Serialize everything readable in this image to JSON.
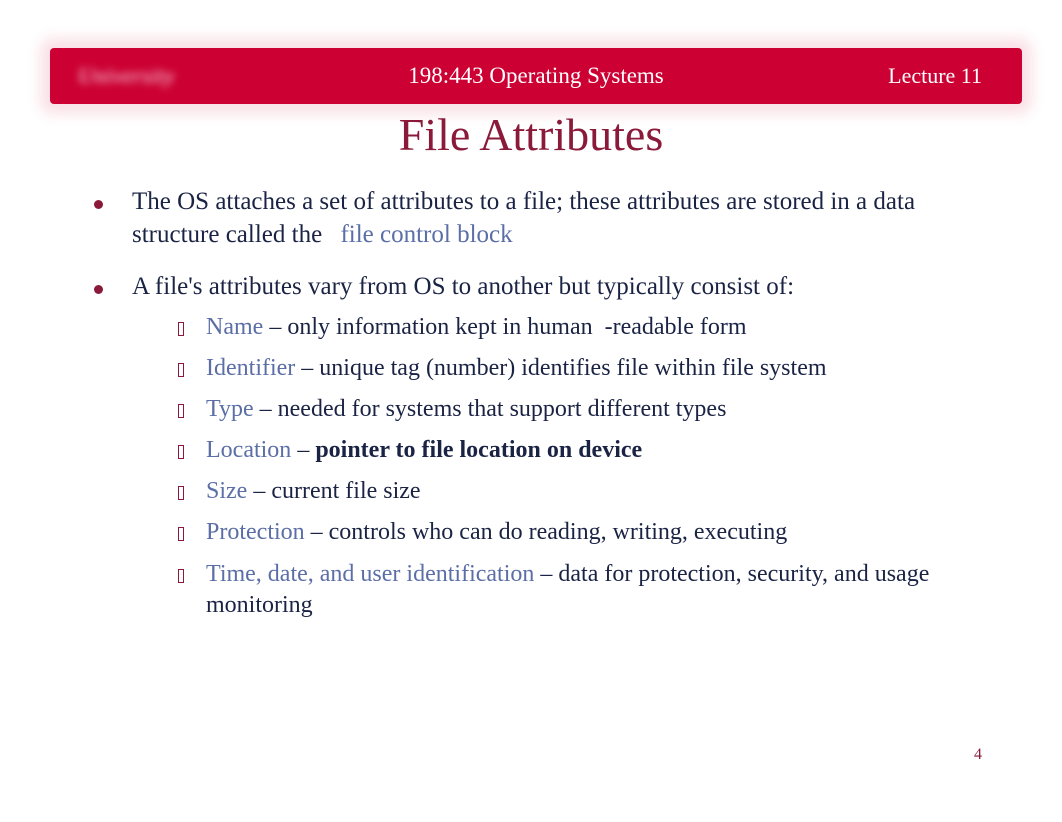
{
  "header": {
    "logo": "University",
    "center": "198:443 Operating Systems",
    "right": "Lecture 11"
  },
  "title": "File Attributes",
  "points": {
    "p1_prefix": "The OS attaches a set of attributes to a file; these attributes are stored in a data structure called the",
    "p1_term": "file control block",
    "p2": "A file's attributes vary from OS to another but typically consist of:"
  },
  "attrs": {
    "name": {
      "label": "Name",
      "desc": " – only information kept in human  -readable form"
    },
    "identifier": {
      "label": "Identifier",
      "desc": " – unique tag (number) identifies file within file system"
    },
    "type": {
      "label": "Type",
      "desc": " – needed for systems that support different types"
    },
    "location": {
      "label": "Location",
      "dash": " – ",
      "desc": "pointer to file location on device"
    },
    "size": {
      "label": "Size",
      "desc": " – current file size"
    },
    "protection": {
      "label": "Protection",
      "desc": " – controls who can do reading, writing, executing"
    },
    "time": {
      "label": "Time, date, and user identification",
      "desc": " – data for protection, security, and usage monitoring"
    }
  },
  "page_number": "4",
  "colors": {
    "brand_red": "#cc0033",
    "title_maroon": "#8b1a3a",
    "body_navy": "#1a2344",
    "term_blue": "#5b6ea6"
  }
}
